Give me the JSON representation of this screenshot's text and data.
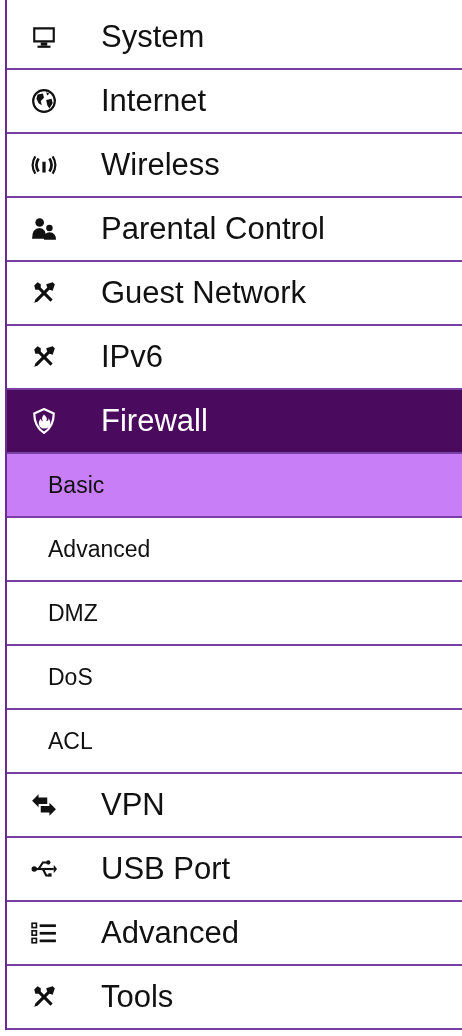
{
  "items": [
    {
      "label": "System",
      "selected": false
    },
    {
      "label": "Internet",
      "selected": false
    },
    {
      "label": "Wireless",
      "selected": false
    },
    {
      "label": "Parental Control",
      "selected": false
    },
    {
      "label": "Guest Network",
      "selected": false
    },
    {
      "label": "IPv6",
      "selected": false
    },
    {
      "label": "Firewall",
      "selected": true,
      "expanded": true,
      "children": [
        {
          "label": "Basic",
          "selected": true
        },
        {
          "label": "Advanced",
          "selected": false
        },
        {
          "label": "DMZ",
          "selected": false
        },
        {
          "label": "DoS",
          "selected": false
        },
        {
          "label": "ACL",
          "selected": false
        }
      ]
    },
    {
      "label": "VPN",
      "selected": false
    },
    {
      "label": "USB Port",
      "selected": false
    },
    {
      "label": "Advanced",
      "selected": false
    },
    {
      "label": "Tools",
      "selected": false
    }
  ]
}
